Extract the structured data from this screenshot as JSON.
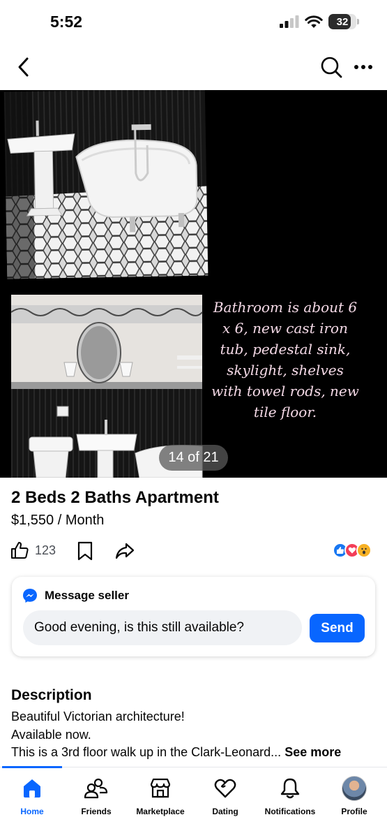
{
  "status_bar": {
    "time": "5:52",
    "battery": "32"
  },
  "nav": {
    "back_icon": "chevron-left-icon",
    "search_icon": "search-icon",
    "more_icon": "more-dots-icon"
  },
  "photo": {
    "caption": "Bathroom is about 6 x 6, new cast iron tub, pedestal sink, skylight, shelves with towel rods, new tile floor.",
    "counter": "14 of 21"
  },
  "listing": {
    "title": "2 Beds 2 Baths Apartment",
    "price": "$1,550 / Month",
    "like_count": "123"
  },
  "message": {
    "header": "Message seller",
    "input_value": "Good evening, is this still available?",
    "send_label": "Send"
  },
  "description": {
    "heading": "Description",
    "line1": "Beautiful Victorian architecture!",
    "line2": "Available now.",
    "line3": "This is a 3rd floor walk up in the Clark-Leonard...",
    "see_more": "See more"
  },
  "tabs": {
    "home": "Home",
    "friends": "Friends",
    "marketplace": "Marketplace",
    "dating": "Dating",
    "notifications": "Notifications",
    "profile": "Profile"
  },
  "colors": {
    "accent": "#0866ff",
    "caption": "#f4d9e6"
  }
}
